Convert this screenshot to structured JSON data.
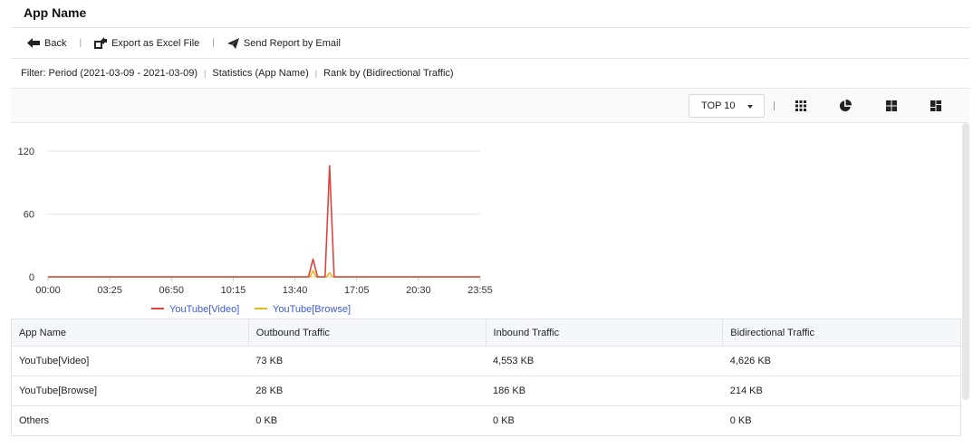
{
  "page": {
    "title": "App Name"
  },
  "toolbar": {
    "back_label": "Back",
    "export_label": "Export as Excel File",
    "email_label": "Send Report by Email"
  },
  "filter": {
    "period": "Filter: Period (2021-03-09 - 2021-03-09)",
    "statistics": "Statistics (App Name)",
    "rank": "Rank by (Bidirectional Traffic)"
  },
  "controls": {
    "top_select_value": "TOP 10",
    "view_icons": [
      "grid-icon",
      "pie-chart-icon",
      "tiles-icon",
      "dashboard-icon"
    ]
  },
  "chart_data": {
    "type": "line",
    "x_ticks": [
      "00:00",
      "03:25",
      "06:50",
      "10:15",
      "13:40",
      "17:05",
      "20:30",
      "23:55"
    ],
    "y_ticks": [
      0,
      60,
      120
    ],
    "ylim": [
      0,
      120
    ],
    "grid": true,
    "legend_position": "bottom",
    "series": [
      {
        "name": "YouTube[Video]",
        "color": "#e0433f",
        "points": [
          [
            "00:00",
            0
          ],
          [
            "14:25",
            0
          ],
          [
            "14:40",
            17
          ],
          [
            "14:55",
            0
          ],
          [
            "15:20",
            0
          ],
          [
            "15:35",
            106
          ],
          [
            "15:50",
            0
          ],
          [
            "23:55",
            0
          ]
        ]
      },
      {
        "name": "YouTube[Browse]",
        "color": "#e8b820",
        "points": [
          [
            "00:00",
            0
          ],
          [
            "14:30",
            0
          ],
          [
            "14:40",
            6
          ],
          [
            "14:50",
            0
          ],
          [
            "15:25",
            0
          ],
          [
            "15:35",
            4
          ],
          [
            "15:45",
            0
          ],
          [
            "23:55",
            0
          ]
        ]
      }
    ]
  },
  "table": {
    "headers": [
      "App Name",
      "Outbound Traffic",
      "Inbound Traffic",
      "Bidirectional Traffic"
    ],
    "rows": [
      [
        "YouTube[Video]",
        "73 KB",
        "4,553 KB",
        "4,626 KB"
      ],
      [
        "YouTube[Browse]",
        "28 KB",
        "186 KB",
        "214 KB"
      ],
      [
        "Others",
        "0 KB",
        "0 KB",
        "0 KB"
      ]
    ]
  }
}
